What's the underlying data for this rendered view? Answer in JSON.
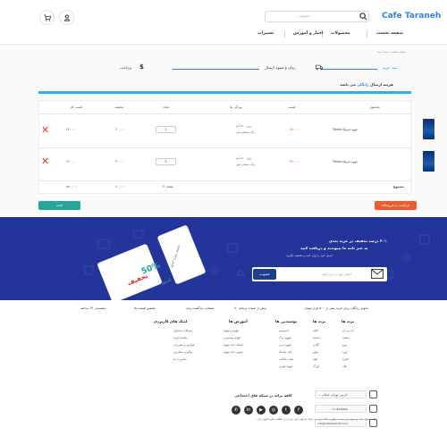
{
  "header": {
    "logo": "Cafe Taraneh",
    "search_placeholder": "جستجو ...",
    "nav": [
      "صفحه نخست",
      "محصولات",
      "اخبار و آموزش",
      "تعمیرات"
    ]
  },
  "breadcrumb": "صفحه نخست / سبد خرید",
  "steps": [
    "سبد خرید",
    "زمان و شیوه ارسال",
    "پرداخت"
  ],
  "cart": {
    "title_prefix": "هزینه ارسال",
    "title_highlight": "رایگان",
    "title_suffix": "می باشد",
    "columns": [
      "محصول",
      "قیمت",
      "ویژگی ها",
      "تعداد",
      "تخفیف",
      "قیمت کل"
    ],
    "rows": [
      {
        "name": "قهوه عربیکا Tchibo",
        "price": "۲۸۰,۰۰۰",
        "options": [
          "وزن ۵۰۰ گرم",
          "رنگ: مشکی سبز"
        ],
        "qty": "1",
        "discount": "۳۰,۰۰۰",
        "total": "۲۴۰,۰۰۰"
      },
      {
        "name": "قهوه عربیکا Tchibo",
        "price": "۳۲۰,۰۰۰",
        "options": [
          "وزن ۵۰۰ گرم",
          "رنگ: مشکی سبز"
        ],
        "qty": "2",
        "discount": "۳۰,۰۰۰",
        "total": "۶۴۰,۰۰۰"
      }
    ],
    "summary_label": "مجموع",
    "summary_count_label": "تعداد: ۳",
    "summary_discount": "۶۰,۰۰۰",
    "summary_total": "۸۸۰,۰۰۰",
    "continue_label": "ادامه",
    "back_label": "بازگشت به فروشگاه"
  },
  "promo": {
    "headline": "۲۰٪ درصد تخفیف در خرید بعدی",
    "sub1": "به خبر نامه ما بپیوندید و دریافت کنید",
    "sub2": "ایمیل خود را وارد کنید و تخفیف بگیرید",
    "email_placeholder": "ایمیل خود را وارد کنید",
    "submit": "عضویت",
    "coupon_percent": "50%",
    "coupon_word": "تخفیف",
    "coupon_word2": "امروز",
    "coupon_side": "تخفیف ویژه امروز"
  },
  "features": [
    "تحویل رایگان برای خرید بیش از ۵۰۰ هزار تومان",
    "بیش از صحت برنامه ۷۰",
    "ضمانت بازگشت وجه",
    "تضمین قیمت ها",
    "پشتیبانی ۲۴ ساعته"
  ],
  "footer": {
    "columns": [
      {
        "title": "برند ها",
        "links": [
          "ای.بی.ان",
          "سفید",
          "نیرو",
          "اورد",
          "لاوازا",
          "بلک"
        ]
      },
      {
        "title": "برند ها",
        "links": [
          "کافه",
          "پاشنه",
          "گلدن",
          "مولو",
          "تلفه",
          "اورگ"
        ]
      },
      {
        "title": "نوشیدنی ها",
        "links": [
          "اسپرسو",
          "قهوه ترک",
          "قهوه دمی",
          "چای ماسالا",
          "هات چاکلت",
          "قهوه فوری"
        ]
      },
      {
        "title": "آموزش ها",
        "links": [
          "قهوه و قهوه",
          "انواع نوشیدنی",
          "کشک خانه قهوه",
          "تجهیز خانه قهوه"
        ]
      },
      {
        "title": "لینک های کاربردی",
        "links": [
          "سوالات متداول",
          "راهنما خرید",
          "قوانین و مقررات",
          "پیگیری سفارش",
          "تماس با ما"
        ]
      }
    ],
    "address": "آدرس: تهران، خیابان ...",
    "phone": "۰۲۱-۸۸۸۸۸۸۸",
    "email": "info@cafetaraneh.com",
    "social_title": "کافه ترانه در شبکه های اجتماعی",
    "copyright": "کلیه حقوق مادی و معنوی این سایت متعلق به کافه ترانه می باشد. هرگونه کپی برداری از مطالب پیگرد قانونی دارد."
  }
}
